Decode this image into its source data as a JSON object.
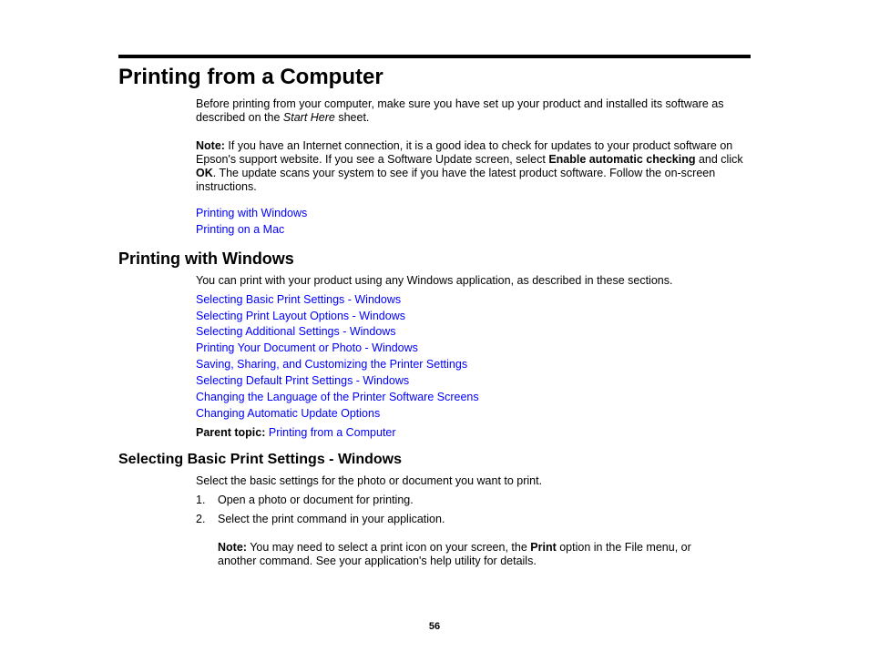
{
  "page": {
    "title": "Printing from a Computer",
    "intro": {
      "before": "Before printing from your computer, make sure you have set up your product and installed its software as described on the ",
      "italic": "Start Here",
      "after": " sheet."
    },
    "note": {
      "label": "Note:",
      "text1": " If you have an Internet connection, it is a good idea to check for updates to your product software on Epson's support website. If you see a Software Update screen, select ",
      "bold1": "Enable automatic checking",
      "text2": " and click ",
      "bold2": "OK",
      "text3": ". The update scans your system to see if you have the latest product software. Follow the on-screen instructions."
    },
    "top_links": [
      "Printing with Windows",
      "Printing on a Mac"
    ],
    "page_number": "56"
  },
  "windows_section": {
    "heading": "Printing with Windows",
    "intro": "You can print with your product using any Windows application, as described in these sections.",
    "links": [
      "Selecting Basic Print Settings - Windows",
      "Selecting Print Layout Options - Windows",
      "Selecting Additional Settings - Windows",
      "Printing Your Document or Photo - Windows",
      "Saving, Sharing, and Customizing the Printer Settings",
      "Selecting Default Print Settings - Windows",
      "Changing the Language of the Printer Software Screens",
      "Changing Automatic Update Options"
    ],
    "parent_label": "Parent topic:",
    "parent_link": "Printing from a Computer"
  },
  "basic_section": {
    "heading": "Selecting Basic Print Settings - Windows",
    "intro": "Select the basic settings for the photo or document you want to print.",
    "steps": [
      {
        "num": "1.",
        "text": "Open a photo or document for printing."
      },
      {
        "num": "2.",
        "text": "Select the print command in your application."
      }
    ],
    "note": {
      "label": "Note:",
      "text1": " You may need to select a print icon on your screen, the ",
      "bold": "Print",
      "text2": " option in the File menu, or another command. See your application's help utility for details."
    }
  }
}
